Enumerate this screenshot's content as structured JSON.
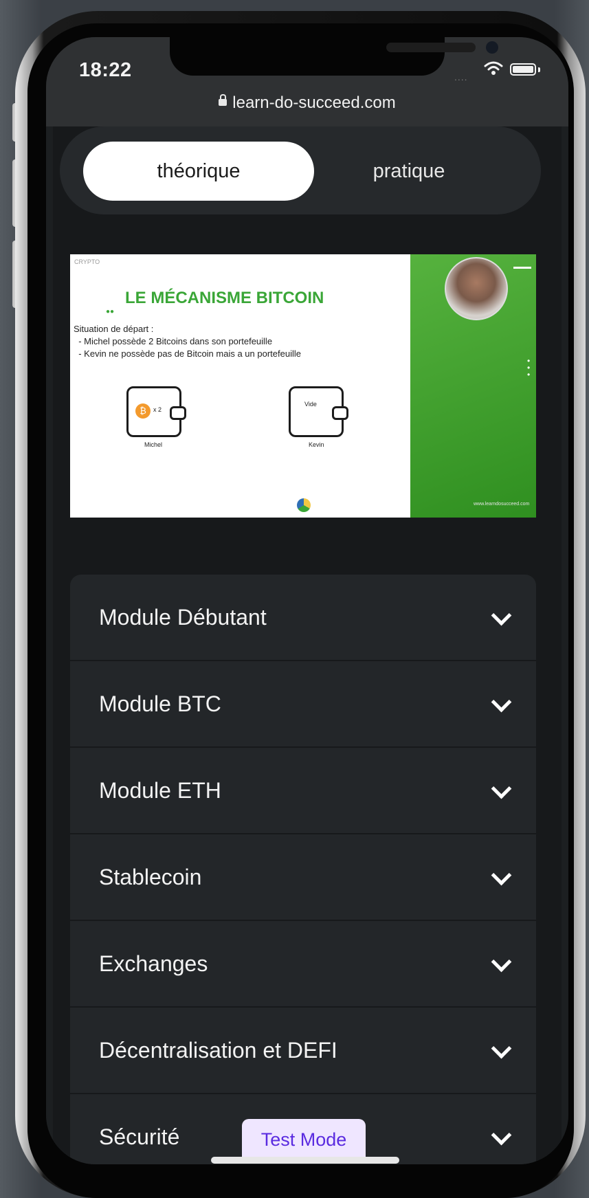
{
  "status_bar": {
    "time": "18:22",
    "url": "learn-do-succeed.com"
  },
  "tabs": [
    {
      "label": "théorique",
      "active": true
    },
    {
      "label": "pratique",
      "active": false
    }
  ],
  "video_slide": {
    "logo_text": "CRYPTO",
    "title": "LE MÉCANISME BITCOIN",
    "lines": [
      "Situation de départ :",
      "  - Michel possède 2 Bitcoins dans son portefeuille",
      "  - Kevin ne possède pas de Bitcoin mais a un portefeuille"
    ],
    "wallet_left_label": "Michel",
    "wallet_left_amount": "x 2",
    "wallet_right_label": "Kevin",
    "wallet_right_content": "Vide",
    "footer": "www.learndosucceed.com"
  },
  "modules": [
    {
      "label": "Module Débutant"
    },
    {
      "label": "Module BTC"
    },
    {
      "label": "Module ETH"
    },
    {
      "label": "Stablecoin"
    },
    {
      "label": "Exchanges"
    },
    {
      "label": "Décentralisation et DEFI"
    },
    {
      "label": "Sécurité"
    }
  ],
  "test_mode_label": "Test Mode",
  "colors": {
    "accent_green": "#3aa637",
    "test_mode_text": "#5a2be0",
    "test_mode_bg": "#efe6ff",
    "card_bg": "#232629"
  }
}
